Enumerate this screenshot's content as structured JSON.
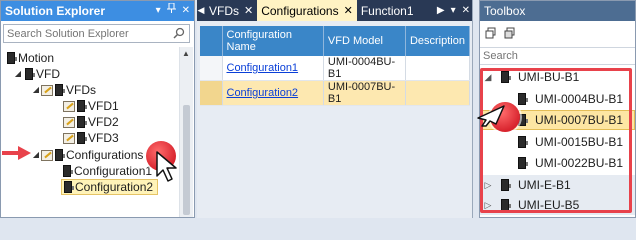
{
  "solution_explorer": {
    "title": "Solution Explorer",
    "pin_icons": "▾ ⊓ ✕",
    "search_placeholder": "Search Solution Explorer",
    "tree": [
      {
        "label": "Motion"
      },
      {
        "label": "VFD"
      },
      {
        "label": "VFDs"
      },
      {
        "label": "VFD1"
      },
      {
        "label": "VFD2"
      },
      {
        "label": "VFD3"
      },
      {
        "label": "Configurations"
      },
      {
        "label": "Configuration1"
      },
      {
        "label": "Configuration2",
        "selected": true
      }
    ]
  },
  "documents": {
    "tabs": [
      {
        "label": "VFDs",
        "active": false
      },
      {
        "label": "Configurations",
        "active": true
      },
      {
        "label": "Function1",
        "active": false
      }
    ],
    "grid": {
      "columns": [
        "Configuration Name",
        "VFD Model",
        "Description"
      ],
      "rows": [
        {
          "name": "Configuration1",
          "model": "UMI-0004BU-B1",
          "description": ""
        },
        {
          "name": "Configuration2",
          "model": "UMI-0007BU-B1",
          "description": "",
          "selected": true
        }
      ]
    }
  },
  "toolbox": {
    "title": "Toolbox",
    "search_placeholder": "Search",
    "items": [
      {
        "label": "UMI-BU-B1",
        "type": "group",
        "expanded": true
      },
      {
        "label": "UMI-0004BU-B1",
        "type": "item"
      },
      {
        "label": "UMI-0007BU-B1",
        "type": "item",
        "selected": true
      },
      {
        "label": "UMI-0015BU-B1",
        "type": "item"
      },
      {
        "label": "UMI-0022BU-B1",
        "type": "item"
      },
      {
        "label": "UMI-E-B1",
        "type": "group",
        "expanded": false
      },
      {
        "label": "UMI-EU-B5",
        "type": "group",
        "expanded": false
      }
    ]
  },
  "colors": {
    "annotation_red": "#e8424b",
    "selection_yellow": "#fde6a3",
    "tab_bar_navy": "#293955",
    "se_title_blue": "#3d8ee2"
  }
}
